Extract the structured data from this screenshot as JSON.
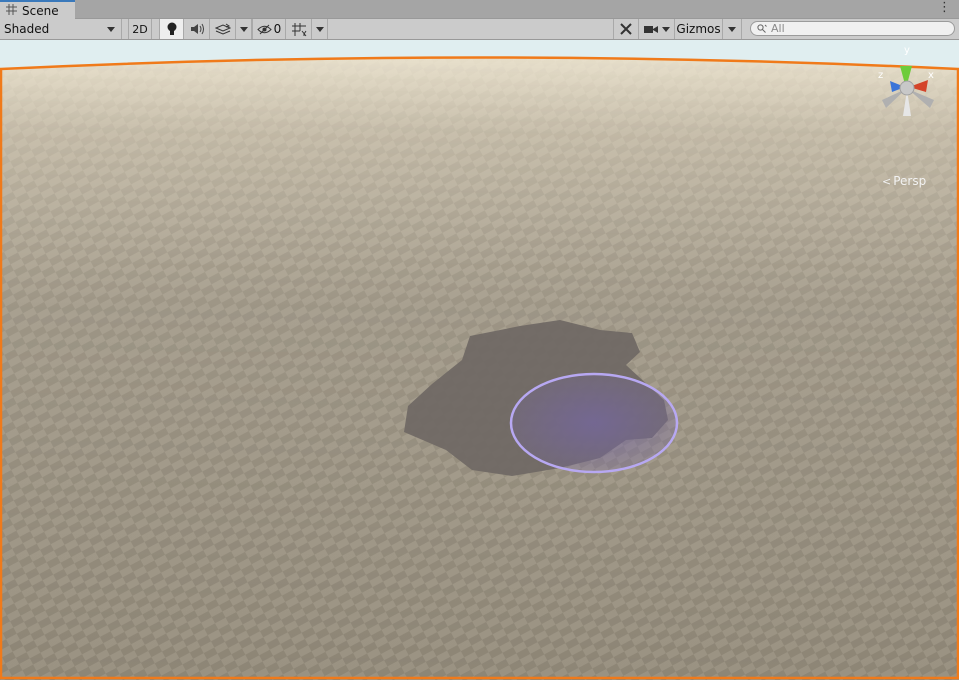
{
  "window": {
    "tab_label": "Scene",
    "tab_icon": "grid-icon",
    "menu_icon": "kebab-menu-icon"
  },
  "toolbar": {
    "shading_mode": "Shaded",
    "mode_2d_label": "2D",
    "hidden_count": "0",
    "gizmos_label": "Gizmos",
    "search_placeholder": "All"
  },
  "scene_view": {
    "projection_label": "Persp",
    "gizmo_axes": {
      "y": "y",
      "x": "x",
      "z": "z"
    },
    "selection_outline_color": "#f07a1a",
    "sky_color": "#d2ebee",
    "ground_color": "#9c9484",
    "brush_color": "#b7a8f2"
  }
}
